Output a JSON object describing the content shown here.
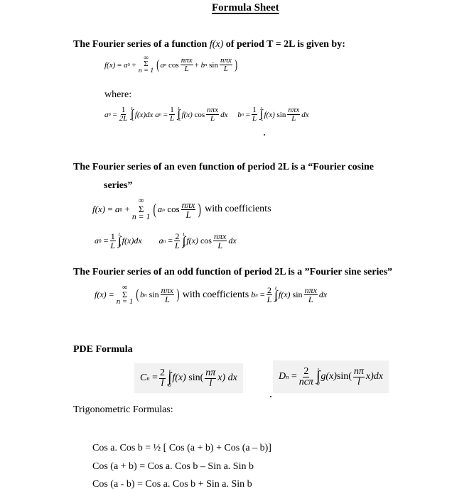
{
  "title": "Formula Sheet",
  "sections": {
    "fourier_general": {
      "heading_pre": "The Fourier series of a function ",
      "heading_fx": "f(x)",
      "heading_post": " of period T = 2L is given by:",
      "series_lhs": "f(x) = a",
      "where_label": "where:"
    },
    "fourier_cosine": {
      "heading_line1": "The Fourier series of an even function of period 2L is a “Fourier cosine",
      "heading_line2": "series”",
      "with_coefficients": "with coefficients"
    },
    "fourier_sine": {
      "heading": "The Fourier series of an odd function of period 2L is a ”Fourier sine series”",
      "with_coefficients": "with coefficients"
    },
    "pde": {
      "heading": "PDE Formula"
    },
    "trig": {
      "heading": "Trigonometric Formulas:",
      "formulas": [
        "Cos a. Cos b = ½ [ Cos (a + b) + Cos (a – b)]",
        "Cos (a + b) = Cos a. Cos b – Sin a. Sin b",
        "Cos (a - b) = Cos a. Cos b + Sin a. Sin b"
      ]
    }
  },
  "symbols": {
    "infinity": "∞",
    "sigma": "Σ",
    "integral": "∫",
    "n_eq_1": "n = 1",
    "L": "L",
    "negL": "-L",
    "zero": "0",
    "one": "1",
    "two": "2",
    "twoL": "2L",
    "npix": "nπx",
    "npi": "nπ",
    "ncpi": "ncπ",
    "l": "l",
    "fx": "f(x)",
    "gx": "g(x)",
    "dx": "dx",
    "cos": "cos",
    "sin": "sin",
    "sin_open": "sin(",
    "x_close": "x)",
    "a": "a",
    "b": "b",
    "C": "C",
    "D": "D",
    "n": "n",
    "eq": "=",
    "plus": "+",
    "lparen": "(",
    "rparen": ")",
    "fx_eq": "f(x) ="
  }
}
